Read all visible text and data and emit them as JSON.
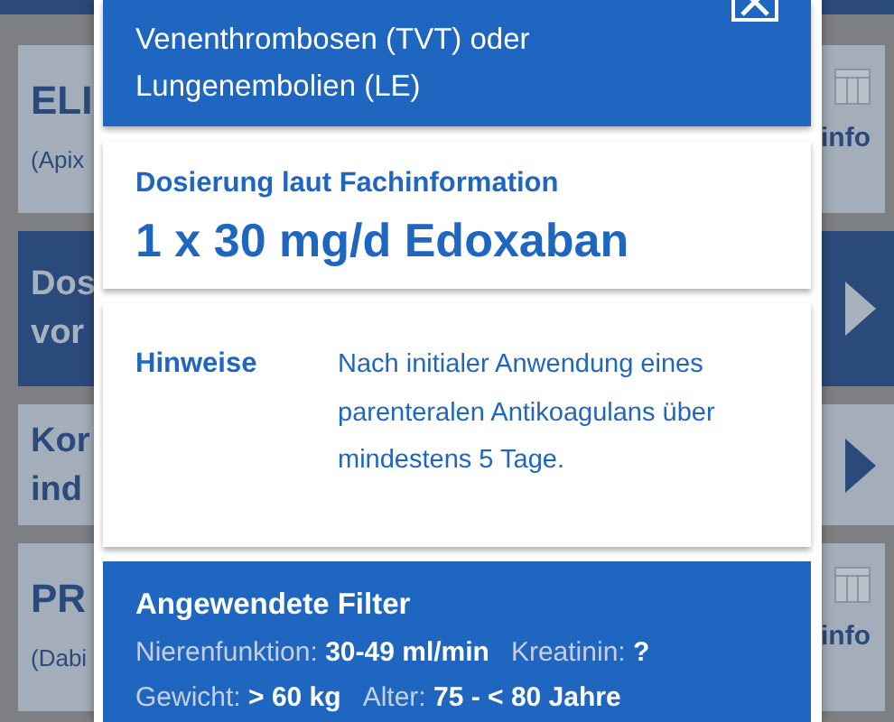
{
  "background_cards": [
    {
      "kind": "info",
      "title": "ELI",
      "subtitle": "(Apix",
      "link": "info"
    },
    {
      "kind": "nav",
      "dark": true,
      "lines": [
        "Dos",
        "vor"
      ]
    },
    {
      "kind": "nav",
      "dark": false,
      "lines": [
        "Kor",
        "ind"
      ]
    },
    {
      "kind": "info",
      "title": "PR",
      "subtitle": "(Dabi",
      "link": "info"
    }
  ],
  "dialog": {
    "header": "Venenthrombosen (TVT) oder Lungenembolien (LE)",
    "dosage_label": "Dosierung laut Fachinformation",
    "dosage": "1 x 30 mg/d Edoxaban",
    "notes_label": "Hinweise",
    "notes": "Nach initialer Anwendung eines parenteralen Antikoagulans über mindestens 5 Tage.",
    "filters_title": "Angewendete Filter",
    "filter_rows": [
      [
        {
          "label": "Nierenfunktion:",
          "value": "30-49 ml/min"
        },
        {
          "label": "Kreatinin:",
          "value": "?"
        }
      ],
      [
        {
          "label": "Gewicht:",
          "value": "> 60 kg"
        },
        {
          "label": "Alter:",
          "value": "75 - < 80 Jahre"
        }
      ]
    ]
  }
}
